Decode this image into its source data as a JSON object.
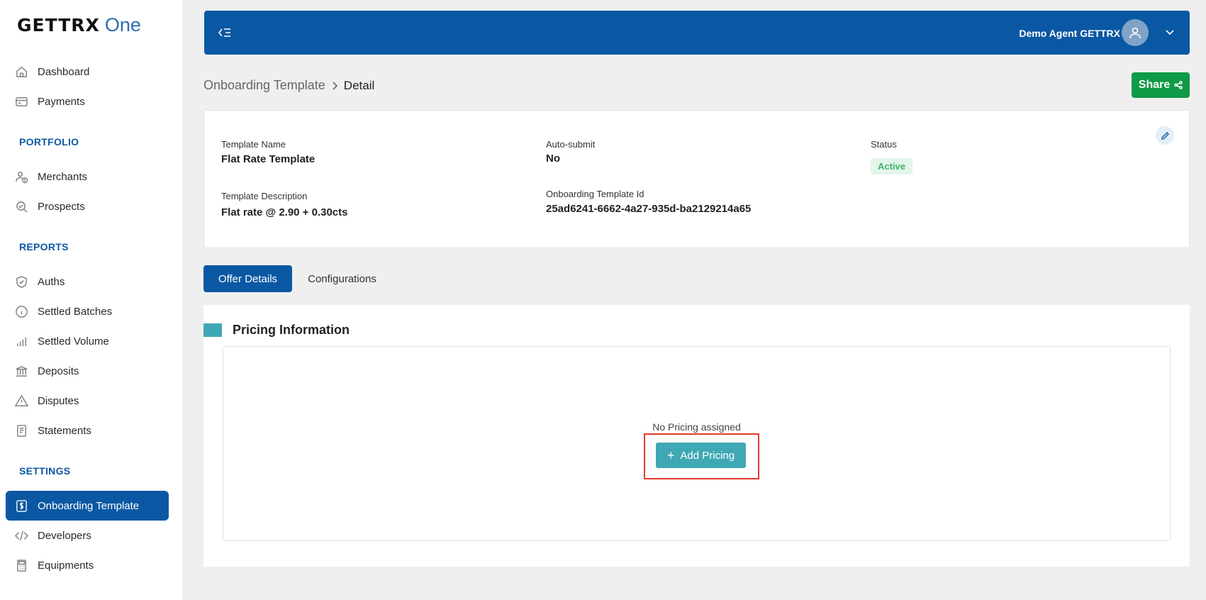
{
  "brand": {
    "name": "GETTRX",
    "suffix": "One"
  },
  "sidebar": {
    "main": [
      {
        "label": "Dashboard",
        "icon": "home-icon"
      },
      {
        "label": "Payments",
        "icon": "card-icon"
      }
    ],
    "sections": [
      {
        "title": "PORTFOLIO",
        "items": [
          {
            "label": "Merchants",
            "icon": "users-dollar-icon"
          },
          {
            "label": "Prospects",
            "icon": "search-check-icon"
          }
        ]
      },
      {
        "title": "REPORTS",
        "items": [
          {
            "label": "Auths",
            "icon": "shield-check-icon"
          },
          {
            "label": "Settled Batches",
            "icon": "info-circle-icon"
          },
          {
            "label": "Settled Volume",
            "icon": "bar-chart-icon"
          },
          {
            "label": "Deposits",
            "icon": "bank-icon"
          },
          {
            "label": "Disputes",
            "icon": "warning-icon"
          },
          {
            "label": "Statements",
            "icon": "receipt-icon"
          }
        ]
      },
      {
        "title": "SETTINGS",
        "items": [
          {
            "label": "Onboarding Template",
            "icon": "dollar-doc-icon",
            "active": true
          },
          {
            "label": "Developers",
            "icon": "code-icon"
          },
          {
            "label": "Equipments",
            "icon": "terminal-icon"
          }
        ]
      }
    ]
  },
  "topbar": {
    "user_name": "Demo Agent GETTRX"
  },
  "breadcrumb": {
    "parent": "Onboarding Template",
    "current": "Detail"
  },
  "share": {
    "label": "Share"
  },
  "template": {
    "name_label": "Template Name",
    "name_value": "Flat Rate Template",
    "desc_label": "Template Description",
    "desc_value": "Flat rate @ 2.90 + 0.30cts",
    "autosubmit_label": "Auto-submit",
    "autosubmit_value": "No",
    "id_label": "Onboarding Template Id",
    "id_value": "25ad6241-6662-4a27-935d-ba2129214a65",
    "status_label": "Status",
    "status_value": "Active"
  },
  "tabs": [
    {
      "label": "Offer Details",
      "active": true
    },
    {
      "label": "Configurations",
      "active": false
    }
  ],
  "pricing": {
    "title": "Pricing Information",
    "empty_text": "No Pricing assigned",
    "add_label": "Add Pricing"
  },
  "colors": {
    "primary": "#0a58a3",
    "accent": "#3fa8b4",
    "success": "#0e9a47",
    "highlight": "#e23b2b"
  }
}
